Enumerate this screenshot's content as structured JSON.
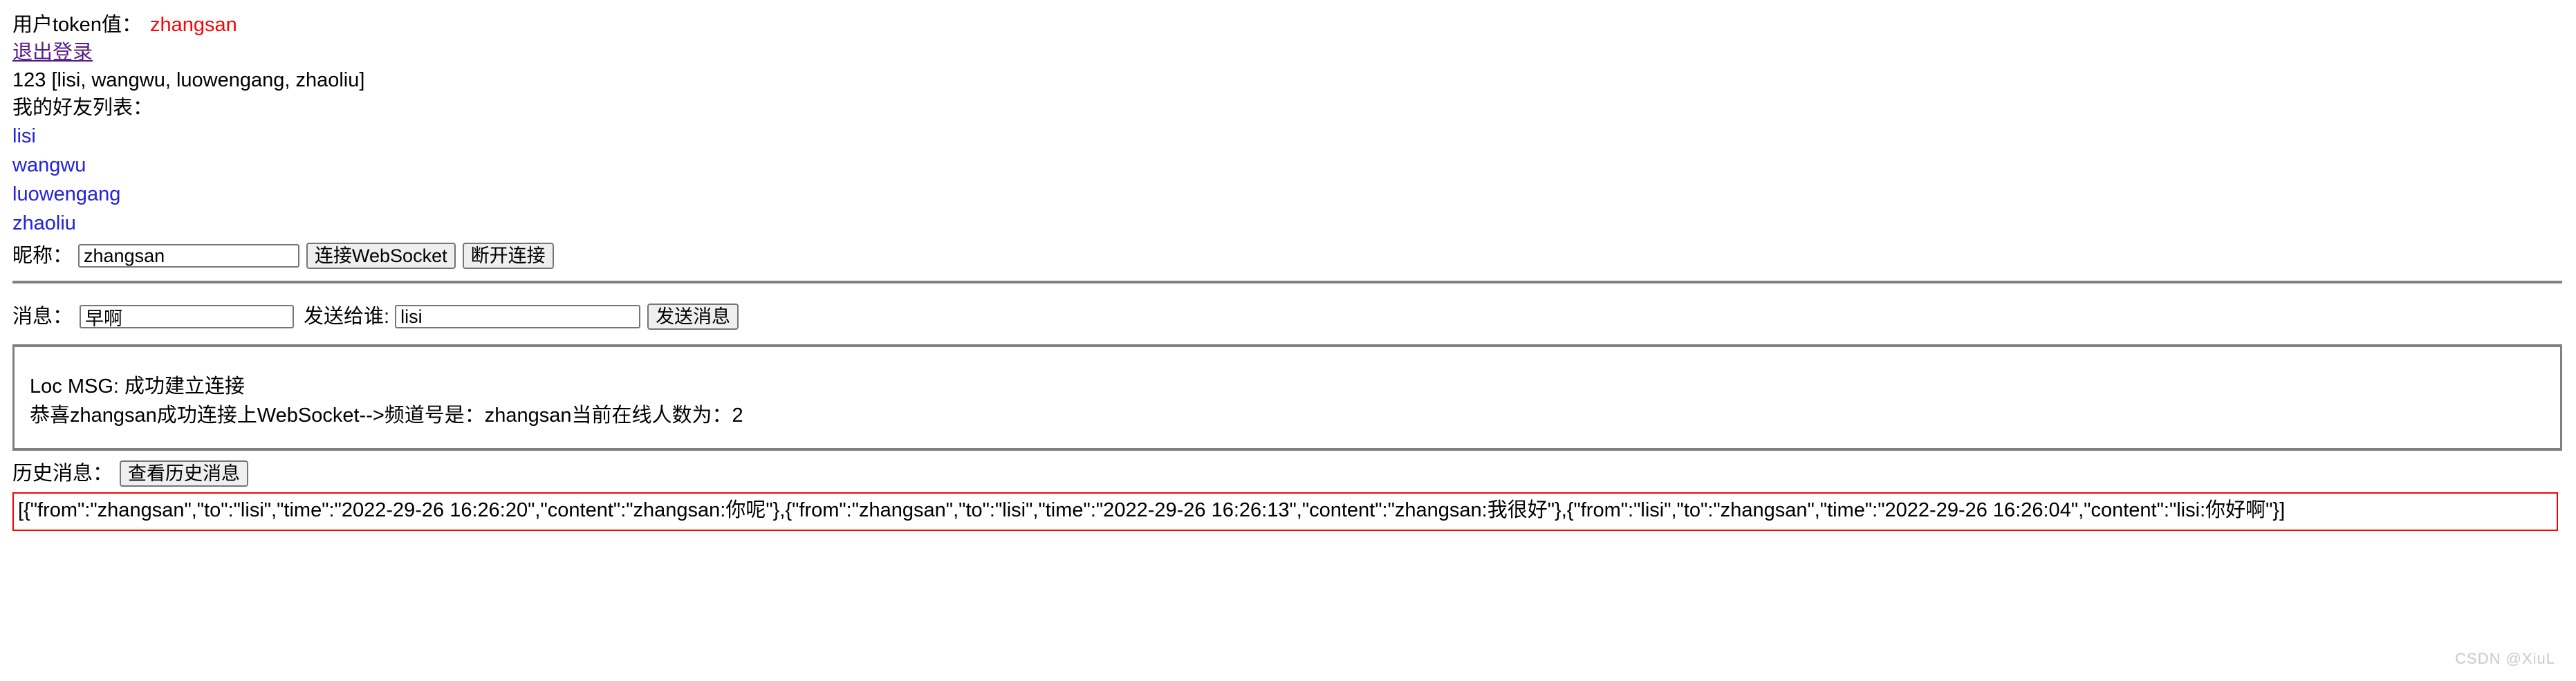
{
  "header": {
    "token_label": "用户token值：",
    "token_value": "zhangsan",
    "logout_link": "退出登录",
    "raw_info": "123 [lisi, wangwu, luowengang, zhaoliu]",
    "friends_title": "我的好友列表："
  },
  "friends": [
    {
      "name": "lisi"
    },
    {
      "name": "wangwu"
    },
    {
      "name": "luowengang"
    },
    {
      "name": "zhaoliu"
    }
  ],
  "connect_row": {
    "nickname_label": "昵称：",
    "nickname_value": "zhangsan",
    "nickname_placeholder": "",
    "connect_button": "连接WebSocket",
    "disconnect_button": "断开连接"
  },
  "send_row": {
    "message_label": "消息：",
    "message_value": "早啊",
    "message_placeholder": "",
    "target_label": "发送给谁:",
    "target_value": "lisi",
    "target_placeholder": "",
    "send_button": "发送消息"
  },
  "log": {
    "lines": [
      "Loc MSG: 成功建立连接",
      "恭喜zhangsan成功连接上WebSocket-->频道号是：zhangsan当前在线人数为：2"
    ]
  },
  "history": {
    "label": "历史消息：",
    "button": "查看历史消息",
    "content": "[{\"from\":\"zhangsan\",\"to\":\"lisi\",\"time\":\"2022-29-26 16:26:20\",\"content\":\"zhangsan:你呢\"},{\"from\":\"zhangsan\",\"to\":\"lisi\",\"time\":\"2022-29-26 16:26:13\",\"content\":\"zhangsan:我很好\"},{\"from\":\"lisi\",\"to\":\"zhangsan\",\"time\":\"2022-29-26 16:26:04\",\"content\":\"lisi:你好啊\"}]"
  },
  "watermark": "CSDN @XiuL",
  "colors": {
    "token_value": "#ff0000",
    "link": "#2222dd",
    "visited_link": "#551a8b",
    "history_border": "#ff0000",
    "separator": "#808080"
  }
}
